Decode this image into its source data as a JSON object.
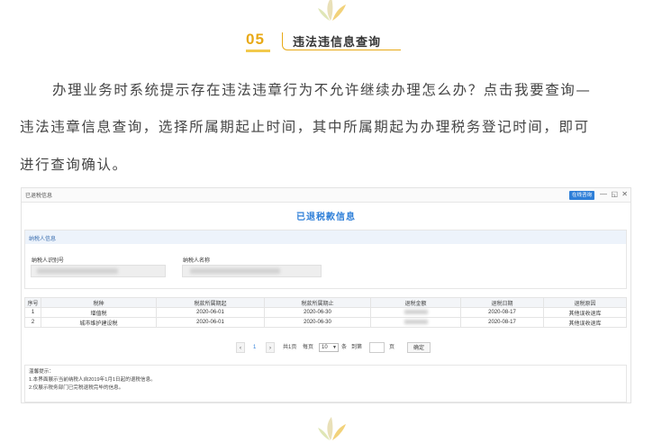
{
  "section": {
    "number": "05",
    "title": "违法违信息查询"
  },
  "paragraph": {
    "line1": "办理业务时系统提示存在违法违章行为不允许继续办理怎么办？点击我要查询—",
    "line2": "违法违章信息查询，选择所属期起止时间，其中所属期起为办理税务登记时间，即可",
    "line3": "进行查询确认。"
  },
  "screenshot": {
    "window_title": "已退税信息",
    "online_button": "在线咨询",
    "window_controls": [
      "—",
      "◱",
      "✕"
    ],
    "heading": "已退税款信息",
    "taxpayer_panel": {
      "title": "纳税人信息",
      "id_label": "纳税人识别号",
      "name_label": "纳税人名称"
    },
    "table": {
      "columns": [
        "序号",
        "税种",
        "税款所属期起",
        "税款所属期止",
        "退税金额",
        "退税日期",
        "退税原因"
      ],
      "rows": [
        {
          "seq": "1",
          "tax": "增值税",
          "start": "2020-06-01",
          "end": "2020-06-30",
          "amount": "",
          "date": "2020-08-17",
          "reason": "其他误收退库"
        },
        {
          "seq": "2",
          "tax": "城市维护建设税",
          "start": "2020-06-01",
          "end": "2020-06-30",
          "amount": "",
          "date": "2020-08-17",
          "reason": "其他误收退库"
        }
      ]
    },
    "pager": {
      "prev": "‹",
      "page": "1",
      "next": "›",
      "total_pages": "共1页",
      "per_page_label": "每页",
      "per_page": "10",
      "unit": "条",
      "goto_label": "到第",
      "page_unit": "页",
      "confirm": "确定"
    },
    "tips": {
      "title": "温馨提示：",
      "line1": "1.本界面展示当前纳税人自2019年1月1日起的退税信息。",
      "line2": "2.仅展示税务部门已完税退税完毕的信息。"
    }
  },
  "colors": {
    "accent_gold": "#e8a916",
    "link_blue": "#2f7fd8",
    "panel_blue": "#edf3fb"
  },
  "icons": {
    "decor": "wheat-leaf-icon"
  }
}
